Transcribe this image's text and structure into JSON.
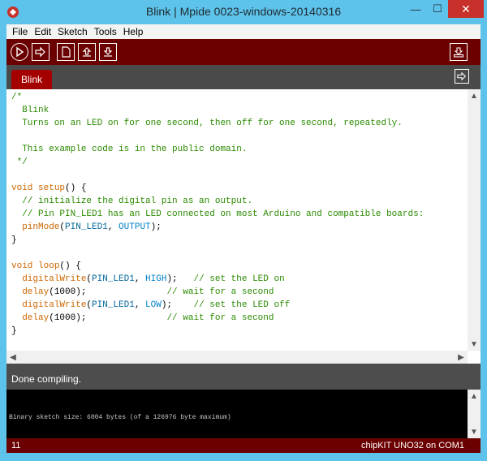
{
  "window": {
    "title": "Blink | Mpide 0023-windows-20140316",
    "minimize": "—",
    "maximize": "☐",
    "close": "✕"
  },
  "menu": [
    "File",
    "Edit",
    "Sketch",
    "Tools",
    "Help"
  ],
  "toolbar": {
    "buttons": [
      "verify-icon",
      "upload-icon",
      "new-icon",
      "open-icon",
      "save-icon",
      "serial-monitor-icon"
    ]
  },
  "tabs": [
    {
      "label": "Blink"
    }
  ],
  "editor": {
    "lines": [
      [
        {
          "t": "/*",
          "c": "comment"
        }
      ],
      [
        {
          "t": "  Blink",
          "c": "comment"
        }
      ],
      [
        {
          "t": "  Turns on an LED on for one second, then off for one second, repeatedly.",
          "c": "comment"
        }
      ],
      [
        {
          "t": "",
          "c": ""
        }
      ],
      [
        {
          "t": "  This example code is in the public domain.",
          "c": "comment"
        }
      ],
      [
        {
          "t": " */",
          "c": "comment"
        }
      ],
      [
        {
          "t": "",
          "c": ""
        }
      ],
      [
        {
          "t": "void",
          "c": "type"
        },
        {
          "t": " ",
          "c": ""
        },
        {
          "t": "setup",
          "c": "func"
        },
        {
          "t": "() {",
          "c": ""
        }
      ],
      [
        {
          "t": "  // initialize the digital pin as an output.",
          "c": "comment"
        }
      ],
      [
        {
          "t": "  // Pin PIN_LED1 has an LED connected on most Arduino and compatible boards:",
          "c": "comment"
        }
      ],
      [
        {
          "t": "  ",
          "c": ""
        },
        {
          "t": "pinMode",
          "c": "func"
        },
        {
          "t": "(",
          "c": ""
        },
        {
          "t": "PIN_LED1",
          "c": "const"
        },
        {
          "t": ", ",
          "c": ""
        },
        {
          "t": "OUTPUT",
          "c": "const2"
        },
        {
          "t": ");",
          "c": ""
        }
      ],
      [
        {
          "t": "}",
          "c": ""
        }
      ],
      [
        {
          "t": "",
          "c": ""
        }
      ],
      [
        {
          "t": "void",
          "c": "type"
        },
        {
          "t": " ",
          "c": ""
        },
        {
          "t": "loop",
          "c": "func"
        },
        {
          "t": "() {",
          "c": ""
        }
      ],
      [
        {
          "t": "  ",
          "c": ""
        },
        {
          "t": "digitalWrite",
          "c": "func"
        },
        {
          "t": "(",
          "c": ""
        },
        {
          "t": "PIN_LED1",
          "c": "const"
        },
        {
          "t": ", ",
          "c": ""
        },
        {
          "t": "HIGH",
          "c": "const2"
        },
        {
          "t": ");   ",
          "c": ""
        },
        {
          "t": "// set the LED on",
          "c": "comment"
        }
      ],
      [
        {
          "t": "  ",
          "c": ""
        },
        {
          "t": "delay",
          "c": "func"
        },
        {
          "t": "(1000);               ",
          "c": ""
        },
        {
          "t": "// wait for a second",
          "c": "comment"
        }
      ],
      [
        {
          "t": "  ",
          "c": ""
        },
        {
          "t": "digitalWrite",
          "c": "func"
        },
        {
          "t": "(",
          "c": ""
        },
        {
          "t": "PIN_LED1",
          "c": "const"
        },
        {
          "t": ", ",
          "c": ""
        },
        {
          "t": "LOW",
          "c": "const2"
        },
        {
          "t": ");    ",
          "c": ""
        },
        {
          "t": "// set the LED off",
          "c": "comment"
        }
      ],
      [
        {
          "t": "  ",
          "c": ""
        },
        {
          "t": "delay",
          "c": "func"
        },
        {
          "t": "(1000);               ",
          "c": ""
        },
        {
          "t": "// wait for a second",
          "c": "comment"
        }
      ],
      [
        {
          "t": "}",
          "c": ""
        }
      ]
    ]
  },
  "status": {
    "text": "Done compiling."
  },
  "console": {
    "text": "Binary sketch size: 6004 bytes (of a 126976 byte maximum)"
  },
  "footer": {
    "line": "11",
    "board": "chipKIT UNO32 on COM1"
  },
  "colors": {
    "toolbar": "#6b0000",
    "tab": "#a40000",
    "titlebar": "#5ec3ea"
  }
}
